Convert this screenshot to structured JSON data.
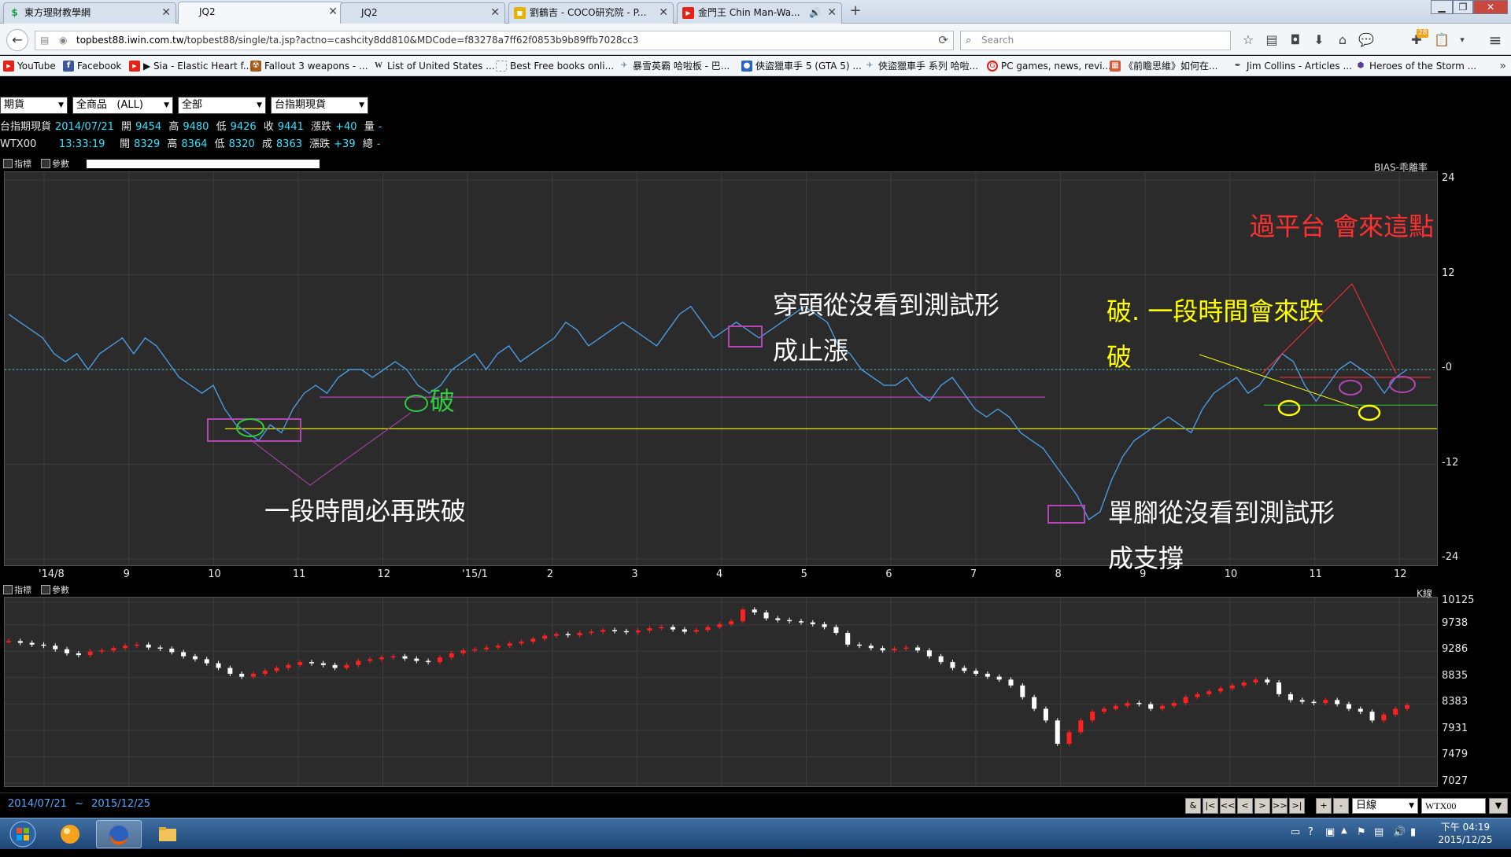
{
  "browser": {
    "tabs": [
      {
        "label": "東方理財教學網",
        "icon": "dollar-icon",
        "icon_color": "#1b9e3e",
        "active": false
      },
      {
        "label": "JQ2",
        "icon": "",
        "active": true
      },
      {
        "label": "JQ2",
        "icon": "",
        "active": false
      },
      {
        "label": "劉鶴吉 - COCO研究院 - P...",
        "icon": "page-icon",
        "icon_color": "#e8b200",
        "active": false
      },
      {
        "label": "金門王 Chin Man-Wa...",
        "icon": "youtube-icon",
        "icon_color": "#e62117",
        "active": false
      }
    ],
    "new_tab": "+",
    "url_host": "topbest88.iwin.com.tw",
    "url_path": "/topbest88/single/ta.jsp?actno=cashcity8dd810&MDCode=f83278a7ff62f0853b9b89ffb7028cc3",
    "search_placeholder": "Search",
    "notification_count": "28",
    "bookmarks": [
      {
        "label": "YouTube",
        "icon": "youtube-icon",
        "color": "#e62117"
      },
      {
        "label": "Facebook",
        "icon": "facebook-icon",
        "color": "#3b5998"
      },
      {
        "label": "▶ Sia - Elastic Heart f...",
        "icon": "youtube-icon",
        "color": "#e62117"
      },
      {
        "label": "Fallout 3 weapons - ...",
        "icon": "game-icon",
        "color": "#a45a1a"
      },
      {
        "label": "List of United States ...",
        "icon": "wikipedia-icon",
        "color": "#666666"
      },
      {
        "label": "Best Free books onli...",
        "icon": "page-icon",
        "color": "#999999"
      },
      {
        "label": "暴雪英霸 哈啦板 - 巴...",
        "icon": "bahamut-icon",
        "color": "#6d8aa3"
      },
      {
        "label": "俠盜獵車手 5 (GTA 5) ...",
        "icon": "gamer-icon",
        "color": "#2b63c0"
      },
      {
        "label": "俠盜獵車手 系列 哈啦...",
        "icon": "bahamut-icon",
        "color": "#6d8aa3"
      },
      {
        "label": "PC games, news, revi...",
        "icon": "gamespot-icon",
        "color": "#d4231e"
      },
      {
        "label": "《前瞻思維》如何在...",
        "icon": "book-icon",
        "color": "#d45a3a"
      },
      {
        "label": "Jim Collins - Articles ...",
        "icon": "feather-icon",
        "color": "#444444"
      },
      {
        "label": "Heroes of the Storm ...",
        "icon": "heroes-icon",
        "color": "#5a3a9a"
      }
    ]
  },
  "filters": {
    "category": "期貨",
    "product": "全商品   (ALL)",
    "scope": "全部",
    "instrument": "台指期現貨"
  },
  "quotes": [
    {
      "name": "台指期現貨",
      "time": "2014/07/21",
      "open_label": "開",
      "open": "9454",
      "high_label": "高",
      "high": "9480",
      "low_label": "低",
      "low": "9426",
      "close_label": "收",
      "close": "9441",
      "chg_label": "漲跌",
      "chg": "+40",
      "vol_label": "量",
      "vol": "-"
    },
    {
      "name": "WTX00",
      "time": "13:33:19",
      "open_label": "開",
      "open": "8329",
      "high_label": "高",
      "high": "8364",
      "low_label": "低",
      "low": "8320",
      "close_label": "成",
      "close": "8363",
      "chg_label": "漲跌",
      "chg": "+39",
      "vol_label": "總",
      "vol": "-"
    }
  ],
  "panel_buttons": {
    "indicator": "指標",
    "param": "參數"
  },
  "chart_data": [
    {
      "type": "line",
      "title": "BIAS-乖離率",
      "ylim": [
        -24,
        24
      ],
      "yticks": [
        "24",
        "12",
        "0",
        "-12",
        "-24"
      ],
      "xticks": [
        "'14/8",
        "9",
        "10",
        "11",
        "12",
        "'15/1",
        "2",
        "3",
        "4",
        "5",
        "6",
        "7",
        "8",
        "9",
        "10",
        "11",
        "12"
      ],
      "series": [
        {
          "values": [
            7,
            6,
            5,
            4,
            2,
            1,
            2,
            0,
            2,
            3,
            4,
            2,
            4,
            3,
            1,
            -1,
            -2,
            -3,
            -2,
            -5,
            -7,
            -8,
            -9,
            -7,
            -8,
            -5,
            -3,
            -2,
            -3,
            -1,
            0,
            0,
            -1,
            0,
            1,
            0,
            -2,
            -3,
            -2,
            0,
            1,
            2,
            0,
            2,
            3,
            1,
            2,
            3,
            4,
            6,
            5,
            3,
            4,
            5,
            6,
            5,
            4,
            3,
            5,
            7,
            8,
            6,
            4,
            5,
            6,
            5,
            4,
            5,
            6,
            7,
            8,
            7,
            6,
            3,
            2,
            0,
            -1,
            -2,
            -2,
            -1,
            -3,
            -4,
            -2,
            -1,
            -3,
            -5,
            -6,
            -5,
            -6,
            -8,
            -9,
            -10,
            -12,
            -14,
            -16,
            -19,
            -18,
            -14,
            -11,
            -9,
            -8,
            -7,
            -6,
            -7,
            -8,
            -5,
            -3,
            -2,
            -1,
            -3,
            -2,
            0,
            2,
            1,
            -2,
            -4,
            -2,
            0,
            1,
            0,
            -1,
            -3,
            -1,
            0
          ],
          "color": "#4a9be0"
        }
      ],
      "overlay_lines": [
        {
          "color": "#4fd0d0",
          "style": "dotted",
          "level": 0
        },
        {
          "color": "#ffff00",
          "level": -7.5
        },
        {
          "color": "#b446b4",
          "level": -3.5
        },
        {
          "color": "#ff3030",
          "level": -1
        },
        {
          "color": "#2ecc40",
          "level": -4.5
        }
      ]
    },
    {
      "type": "candlestick",
      "title": "K線",
      "ylim": [
        7027,
        10125
      ],
      "yticks": [
        "10125",
        "9738",
        "9286",
        "8835",
        "8383",
        "7931",
        "7479",
        "7027"
      ],
      "series": [
        {
          "values": [
            9460,
            9430,
            9400,
            9380,
            9320,
            9250,
            9220,
            9280,
            9300,
            9340,
            9380,
            9400,
            9350,
            9330,
            9270,
            9200,
            9150,
            9080,
            9000,
            8900,
            8850,
            8900,
            8950,
            9000,
            9050,
            9100,
            9080,
            9050,
            9000,
            9050,
            9120,
            9150,
            9180,
            9200,
            9160,
            9120,
            9100,
            9180,
            9250,
            9300,
            9320,
            9350,
            9380,
            9420,
            9450,
            9500,
            9550,
            9580,
            9560,
            9600,
            9620,
            9650,
            9630,
            9610,
            9640,
            9680,
            9700,
            9660,
            9620,
            9650,
            9700,
            9750,
            9800,
            10000,
            9950,
            9850,
            9820,
            9800,
            9780,
            9750,
            9700,
            9600,
            9400,
            9380,
            9340,
            9300,
            9330,
            9350,
            9300,
            9200,
            9100,
            9000,
            8950,
            8900,
            8850,
            8800,
            8700,
            8500,
            8300,
            8100,
            7700,
            7900,
            8100,
            8250,
            8300,
            8350,
            8400,
            8380,
            8300,
            8350,
            8400,
            8500,
            8550,
            8600,
            8650,
            8700,
            8750,
            8800,
            8750,
            8550,
            8450,
            8420,
            8400,
            8450,
            8380,
            8300,
            8250,
            8100,
            8200,
            8300,
            8363
          ],
          "up_color": "#ff2020",
          "down_color": "#ffffff"
        }
      ]
    }
  ],
  "annotations": [
    {
      "text": "一段時間必再跌破",
      "color": "#ffffff"
    },
    {
      "text": "破",
      "color": "#2ecc40"
    },
    {
      "text": "穿頭從沒看到測試形",
      "color": "#ffffff"
    },
    {
      "text": "成止漲",
      "color": "#ffffff"
    },
    {
      "text": "單腳從沒看到測試形",
      "color": "#ffffff"
    },
    {
      "text": "成支撐",
      "color": "#ffffff"
    },
    {
      "text": "破. 一段時間會來跌",
      "color": "#ffff00"
    },
    {
      "text": "破",
      "color": "#ffff00"
    },
    {
      "text": "過平台 會來這點",
      "color": "#ff3030"
    }
  ],
  "bottom": {
    "date_start": "2014/07/21",
    "tilde": "~",
    "date_end": "2015/12/25",
    "nav_buttons": [
      "&",
      "|<",
      "<<",
      "<",
      ">",
      ">>",
      ">|",
      "+",
      "-"
    ],
    "period": "日線",
    "code": "WTX00"
  },
  "taskbar": {
    "apps": [
      "start-orb",
      "browser-bubble",
      "firefox",
      "folder"
    ],
    "clock_ampm": "下午 04:19",
    "clock_date": "2015/12/25"
  }
}
